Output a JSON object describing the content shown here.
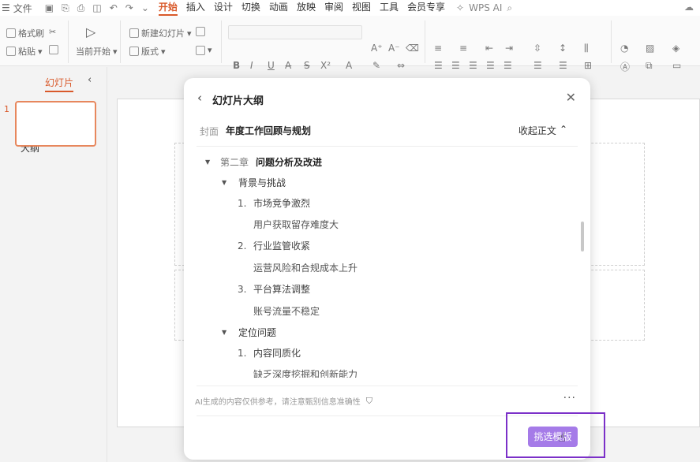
{
  "menubar": {
    "file_label": "文件",
    "tabs": [
      "开始",
      "插入",
      "设计",
      "切换",
      "动画",
      "放映",
      "审阅",
      "视图",
      "工具",
      "会员专享"
    ],
    "active_tab": "开始",
    "wps_ai": "WPS AI"
  },
  "ribbon": {
    "format_painter": "格式刷",
    "paste": "粘贴",
    "start_from_current": "当前开始",
    "new_slide": "新建幻灯片",
    "layout": "版式"
  },
  "left_panel": {
    "tab_outline": "大纲",
    "tab_slides": "幻灯片",
    "slide_number": "1"
  },
  "dialog": {
    "title": "幻灯片大纲",
    "cover_label": "封面",
    "cover_title": "年度工作回顾与规划",
    "collapse_label": "收起正文",
    "chapter_label": "第二章",
    "chapter_title": "问题分析及改进",
    "sections": [
      {
        "title": "背景与挑战",
        "points": [
          {
            "num": "1.",
            "title": "市场竞争激烈",
            "detail": "用户获取留存难度大"
          },
          {
            "num": "2.",
            "title": "行业监管收紧",
            "detail": "运营风险和合规成本上升"
          },
          {
            "num": "3.",
            "title": "平台算法调整",
            "detail": "账号流量不稳定"
          }
        ]
      },
      {
        "title": "定位问题",
        "points": [
          {
            "num": "1.",
            "title": "内容同质化",
            "detail": "缺乏深度挖掘和创新能力"
          }
        ]
      }
    ],
    "disclaimer": "AI生成的内容仅供参考，请注意甄别信息准确性",
    "more": "···",
    "choose_layout": "挑选模版"
  }
}
